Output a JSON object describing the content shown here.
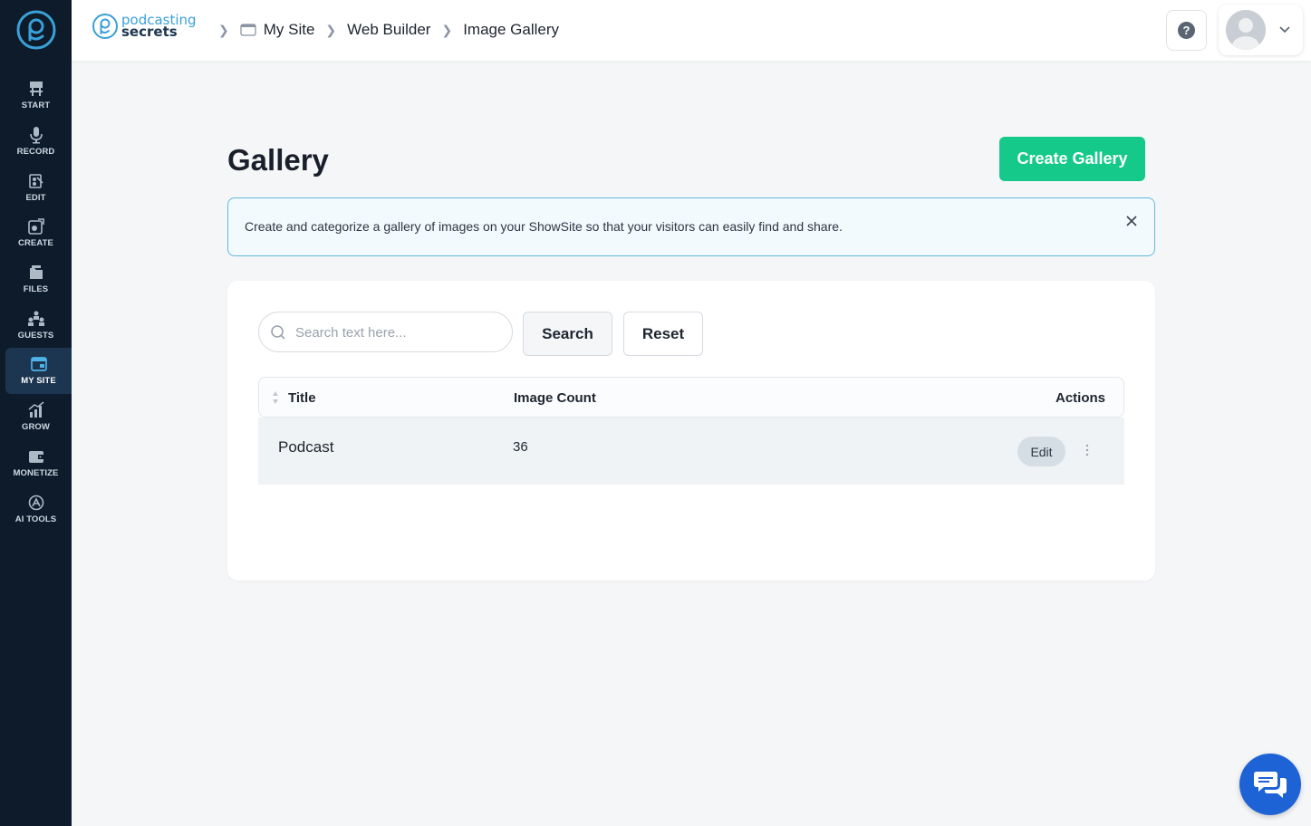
{
  "sidebar": {
    "items": [
      {
        "label": "START",
        "icon": "start-sign-icon"
      },
      {
        "label": "RECORD",
        "icon": "microphone-icon"
      },
      {
        "label": "EDIT",
        "icon": "edit-icon"
      },
      {
        "label": "CREATE",
        "icon": "create-icon"
      },
      {
        "label": "FILES",
        "icon": "files-icon"
      },
      {
        "label": "GUESTS",
        "icon": "guests-icon"
      },
      {
        "label": "MY SITE",
        "icon": "my-site-icon"
      },
      {
        "label": "GROW",
        "icon": "grow-icon"
      },
      {
        "label": "MONETIZE",
        "icon": "monetize-icon"
      },
      {
        "label": "AI TOOLS",
        "icon": "ai-tools-icon"
      }
    ],
    "active": "MY SITE"
  },
  "header": {
    "brand_line1": "podcasting",
    "brand_line2": "secrets",
    "breadcrumbs": [
      "My Site",
      "Web Builder",
      "Image Gallery"
    ]
  },
  "main": {
    "title": "Gallery",
    "create_button": "Create Gallery",
    "info_text": "Create and categorize a gallery of images on your ShowSite so that your visitors can easily find and share.",
    "search_placeholder": "Search text here...",
    "search_button": "Search",
    "reset_button": "Reset",
    "table": {
      "columns": [
        "Title",
        "Image Count",
        "Actions"
      ],
      "rows": [
        {
          "title": "Podcast",
          "image_count": "36",
          "action": "Edit"
        }
      ]
    }
  },
  "colors": {
    "sidebar_bg": "#0d1b2a",
    "primary_green": "#14c98a",
    "info_border": "#63b9dd",
    "chat_blue": "#1e63d6"
  }
}
